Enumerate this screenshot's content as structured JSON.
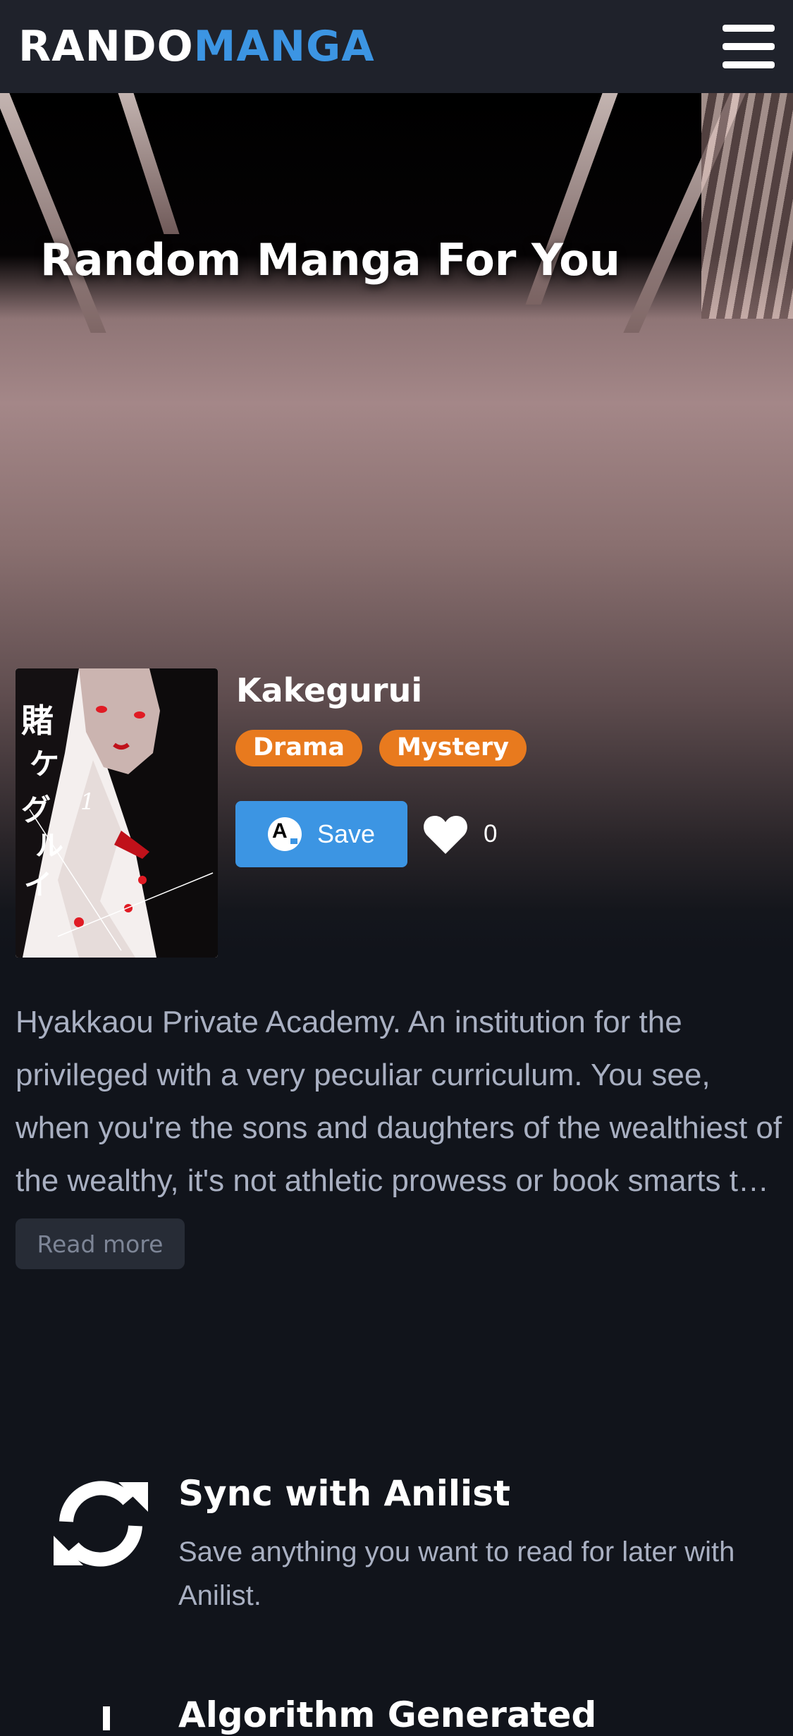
{
  "navbar": {
    "logo_part1": "RANDO",
    "logo_part2": "MANGA",
    "menu_icon": "hamburger-menu-icon"
  },
  "hero": {
    "title": "Random Manga For You"
  },
  "manga": {
    "title": "Kakegurui",
    "genres": [
      "Drama",
      "Mystery"
    ],
    "save_label": "Save",
    "likes": "0",
    "description": "Hyakkaou Private Academy. An institution for the privileged with a very peculiar curriculum. You see, when you're the sons and daughters of the wealthiest of the wealthy, it's not athletic prowess or book smarts that will get you ahead in life.",
    "read_more_label": "Read more",
    "cover_text": "賭ケグルイ",
    "cover_volume": "1"
  },
  "features": [
    {
      "icon": "sync-icon",
      "title": "Sync with Anilist",
      "text": "Save anything you want to read for later with Anilist."
    },
    {
      "icon": "sparkle-icon",
      "title": "Algorithm Generated",
      "text": ""
    }
  ],
  "colors": {
    "accent_blue": "#3c95e3",
    "tag_orange": "#e87a1e",
    "navbar_bg": "#1f222b",
    "page_bg": "#11141b"
  }
}
